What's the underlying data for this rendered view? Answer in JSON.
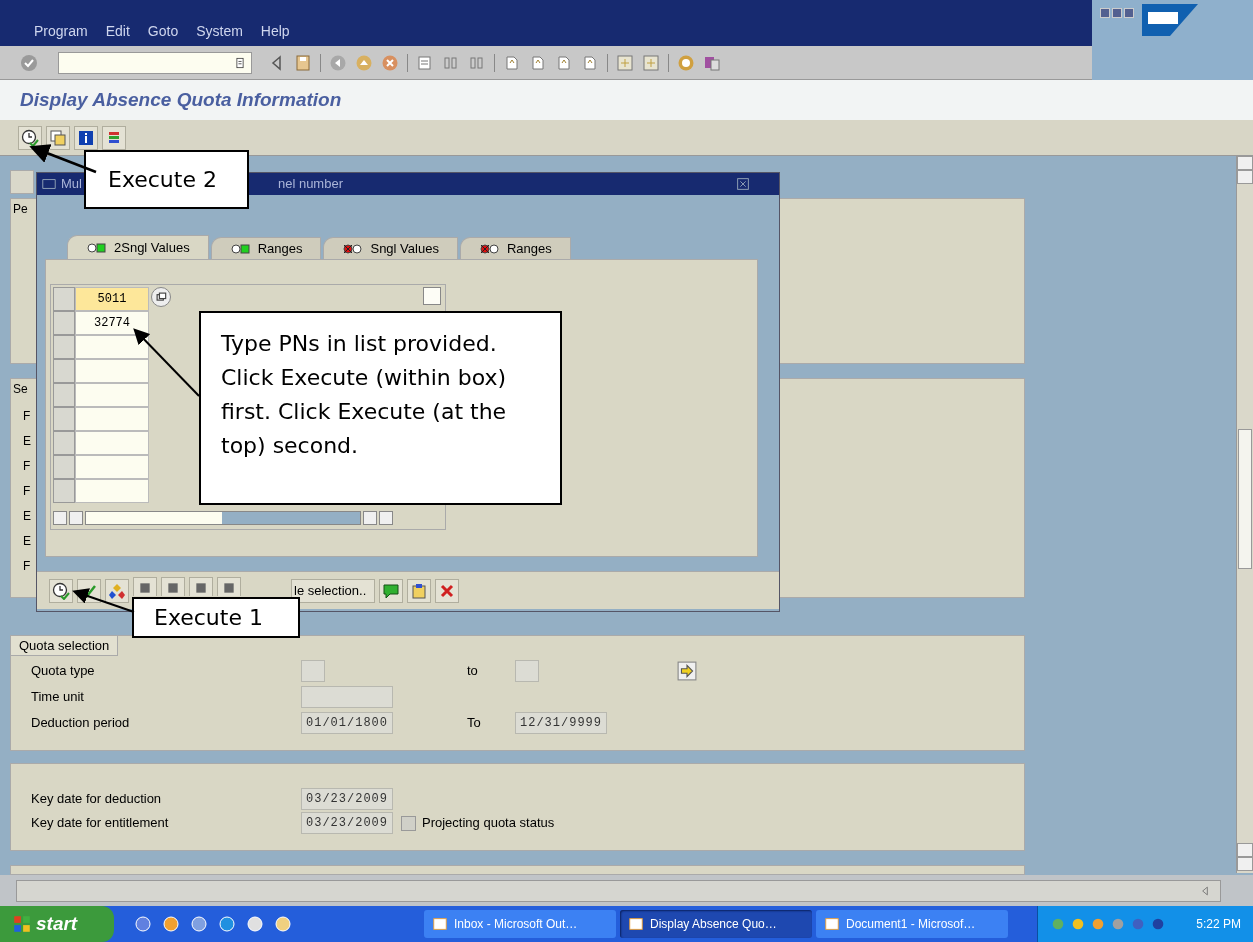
{
  "menu": [
    "Program",
    "Edit",
    "Goto",
    "System",
    "Help"
  ],
  "screen_title": "Display Absence Quota Information",
  "background_groups": {
    "period_label": "Pe",
    "selection_label": "Se",
    "selection_fields": [
      "F",
      "E",
      "F",
      "F",
      "E",
      "E",
      "F"
    ]
  },
  "quota_selection": {
    "title": "Quota selection",
    "quota_type_label": "Quota type",
    "to_label": "to",
    "time_unit_label": "Time unit",
    "deduction_label": "Deduction period",
    "deduction_from": "01/01/1800",
    "deduction_to_label": "To",
    "deduction_to": "12/31/9999"
  },
  "key_dates": {
    "deduction_label": "Key date for deduction",
    "deduction_value": "03/23/2009",
    "entitlement_label": "Key date for entitlement",
    "entitlement_value": "03/23/2009",
    "projecting": {
      "label": "Projecting quota status",
      "checked": false
    }
  },
  "dialog": {
    "title_start": "Mul",
    "title_end": "nel number",
    "tabs": [
      {
        "label": "2Sngl Values",
        "kind": "include",
        "selected": true
      },
      {
        "label": "Ranges",
        "kind": "include",
        "selected": false
      },
      {
        "label": "Sngl Values",
        "kind": "exclude",
        "selected": false
      },
      {
        "label": "Ranges",
        "kind": "exclude",
        "selected": false
      }
    ],
    "values": [
      {
        "value": "5011",
        "selected": true
      },
      {
        "value": "32774",
        "selected": false
      }
    ],
    "selection_button": "le selection.."
  },
  "callouts": [
    {
      "text": "Execute 2",
      "kind": "exec2"
    },
    {
      "text": "Type PNs in list provided.  Click Execute (within box) first.  Click Execute (at the top) second.",
      "kind": "note"
    },
    {
      "text": "Execute 1",
      "kind": "exec1"
    }
  ],
  "taskbar": {
    "start": "start",
    "tasks": [
      {
        "label": "Inbox - Microsoft Out…",
        "selected": false
      },
      {
        "label": "Display Absence Quo…",
        "selected": true
      },
      {
        "label": "Document1 - Microsof…",
        "selected": false
      }
    ],
    "clock": "5:22 PM"
  }
}
